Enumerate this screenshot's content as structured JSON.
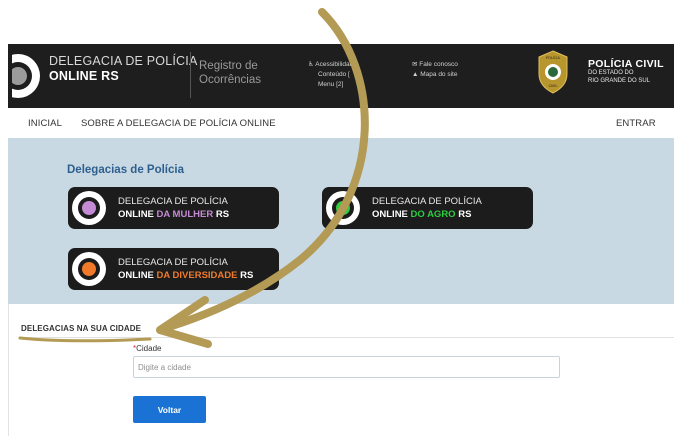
{
  "header": {
    "logo_line1": "DELEGACIA DE POLÍCIA",
    "logo_line2": "ONLINE RS",
    "registro_line1": "Registro de",
    "registro_line2": "Ocorrências",
    "acessibilidade": "Acessibilidade",
    "conteudo": "Conteúdo [",
    "menu": "Menu [2]",
    "fale_conosco": "Fale conosco",
    "mapa_site": "Mapa do site",
    "badge_top": "POLÍCIA",
    "badge_bottom": "CIVIL",
    "pc_title": "POLÍCIA CIVIL",
    "pc_sub1": "DO ESTADO DO",
    "pc_sub2": "RIO GRANDE DO SUL"
  },
  "nav": {
    "inicial": "INICIAL",
    "sobre": "SOBRE A DELEGACIA DE POLÍCIA ONLINE",
    "entrar": "ENTRAR"
  },
  "delegacias": {
    "title": "Delegacias de Polícia",
    "cards": [
      {
        "line1": "DELEGACIA DE POLÍCIA",
        "online": "ONLINE",
        "accent": "DA MULHER",
        "rs": "RS",
        "accent_color": "#c48ad4"
      },
      {
        "line1": "DELEGACIA DE POLÍCIA",
        "online": "ONLINE",
        "accent": "DO AGRO",
        "rs": "RS",
        "accent_color": "#2ecc40"
      },
      {
        "line1": "DELEGACIA DE POLÍCIA",
        "online": "ONLINE",
        "accent": "DA DIVERSIDADE",
        "rs": "RS",
        "accent_color": "#f07a2a"
      }
    ]
  },
  "cidade": {
    "section_title": "DELEGACIAS NA SUA CIDADE",
    "required_mark": "*",
    "label": "Cidade",
    "placeholder": "Digite a cidade",
    "voltar": "Voltar"
  },
  "colors": {
    "header_bg": "#1e1e1e",
    "panel_bg": "#c9d9e3",
    "button_blue": "#1a73d4",
    "arrow_gold": "#b39a55"
  }
}
